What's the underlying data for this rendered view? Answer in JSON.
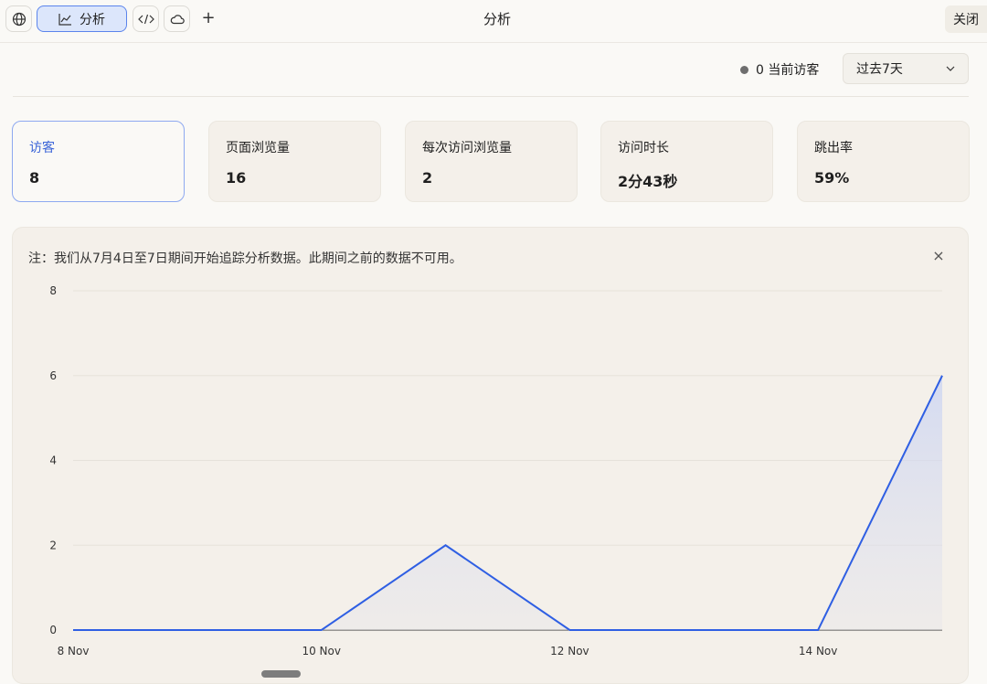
{
  "toolbar": {
    "tabs": [
      {
        "icon": "globe-icon",
        "label": ""
      },
      {
        "icon": "line-chart-icon",
        "label": "分析"
      },
      {
        "icon": "code-icon",
        "label": ""
      },
      {
        "icon": "cloud-icon",
        "label": ""
      }
    ],
    "add_label": "+",
    "title": "分析",
    "close_label": "关闭"
  },
  "header": {
    "current_visitors": "0 当前访客",
    "range": "过去7天"
  },
  "stats": [
    {
      "label": "访客",
      "value": "8"
    },
    {
      "label": "页面浏览量",
      "value": "16"
    },
    {
      "label": "每次访问浏览量",
      "value": "2"
    },
    {
      "label": "访问时长",
      "value": "2分43秒"
    },
    {
      "label": "跳出率",
      "value": "59%"
    }
  ],
  "note": {
    "text": "注：我们从7月4日至7日期间开始追踪分析数据。此期间之前的数据不可用。",
    "close": "×"
  },
  "colors": {
    "accent": "#2f5fe3",
    "active_border": "#8ea9f0"
  },
  "chart_data": {
    "type": "area",
    "x": [
      "8 Nov",
      "9 Nov",
      "10 Nov",
      "11 Nov",
      "12 Nov",
      "13 Nov",
      "14 Nov",
      "15 Nov"
    ],
    "values": [
      0,
      0,
      0,
      2,
      0,
      0,
      0,
      6
    ],
    "x_ticks": [
      "8 Nov",
      "10 Nov",
      "12 Nov",
      "14 Nov"
    ],
    "y_ticks": [
      0,
      2,
      4,
      6,
      8
    ],
    "ylim": [
      0,
      8
    ],
    "grid": true,
    "legend": "none"
  }
}
